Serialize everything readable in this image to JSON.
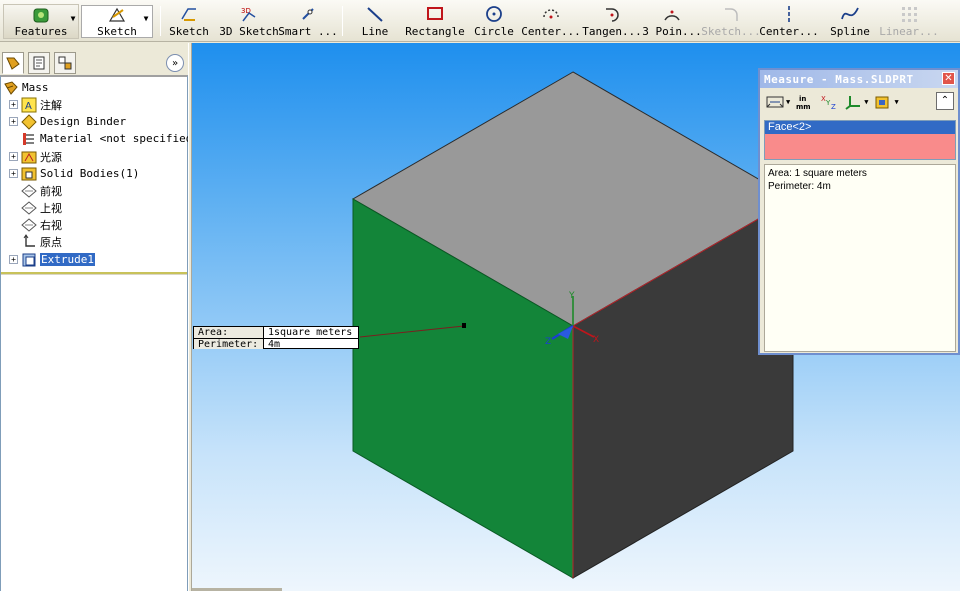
{
  "toolbar": {
    "features_label": "Features",
    "sketch_tab_label": "Sketch",
    "tools": [
      {
        "label": "Sketch",
        "icon": "sketch-icon",
        "enabled": true
      },
      {
        "label": "3D Sketch",
        "icon": "3d-sketch-icon",
        "enabled": true
      },
      {
        "label": "Smart ...",
        "icon": "smart-dimension-icon",
        "enabled": true
      },
      {
        "label": "Line",
        "icon": "line-icon",
        "enabled": true
      },
      {
        "label": "Rectangle",
        "icon": "rectangle-icon",
        "enabled": true
      },
      {
        "label": "Circle",
        "icon": "circle-icon",
        "enabled": true
      },
      {
        "label": "Center...",
        "icon": "centerpoint-arc-icon",
        "enabled": true
      },
      {
        "label": "Tangen...",
        "icon": "tangent-arc-icon",
        "enabled": true
      },
      {
        "label": "3 Poin...",
        "icon": "three-point-arc-icon",
        "enabled": true
      },
      {
        "label": "Sketch...",
        "icon": "sketch-fillet-icon",
        "enabled": false
      },
      {
        "label": "Center...",
        "icon": "centerline-icon",
        "enabled": true
      },
      {
        "label": "Spline",
        "icon": "spline-icon",
        "enabled": true
      },
      {
        "label": "Linear...",
        "icon": "linear-pattern-icon",
        "enabled": false
      }
    ]
  },
  "feature_tree": {
    "root": "Mass",
    "items": [
      {
        "label": "注解",
        "icon": "annotations-icon",
        "expandable": true
      },
      {
        "label": "Design Binder",
        "icon": "design-binder-icon",
        "expandable": true
      },
      {
        "label": "Material <not specified>",
        "icon": "material-icon",
        "expandable": false
      },
      {
        "label": "光源",
        "icon": "lights-icon",
        "expandable": true
      },
      {
        "label": "Solid Bodies(1)",
        "icon": "solid-bodies-icon",
        "expandable": true
      },
      {
        "label": "前视",
        "icon": "plane-icon",
        "expandable": false
      },
      {
        "label": "上视",
        "icon": "plane-icon",
        "expandable": false
      },
      {
        "label": "右视",
        "icon": "plane-icon",
        "expandable": false
      },
      {
        "label": "原点",
        "icon": "origin-icon",
        "expandable": false
      },
      {
        "label": "Extrude1",
        "icon": "extrude-icon",
        "expandable": true,
        "selected": true
      }
    ]
  },
  "callout": {
    "area_label": "Area:",
    "area_value": "1square meters",
    "perimeter_label": "Perimeter:",
    "perimeter_value": "4m"
  },
  "measure": {
    "title": "Measure - Mass.SLDPRT",
    "selection": "Face<2>",
    "results": [
      "Area: 1 square meters",
      "Perimeter: 4m"
    ]
  },
  "colors": {
    "top_face": "#999999",
    "front_face": "#138539",
    "right_face": "#3a3a3a",
    "selection_highlight": "#316ac5",
    "empty_selection": "#f98b8b"
  }
}
